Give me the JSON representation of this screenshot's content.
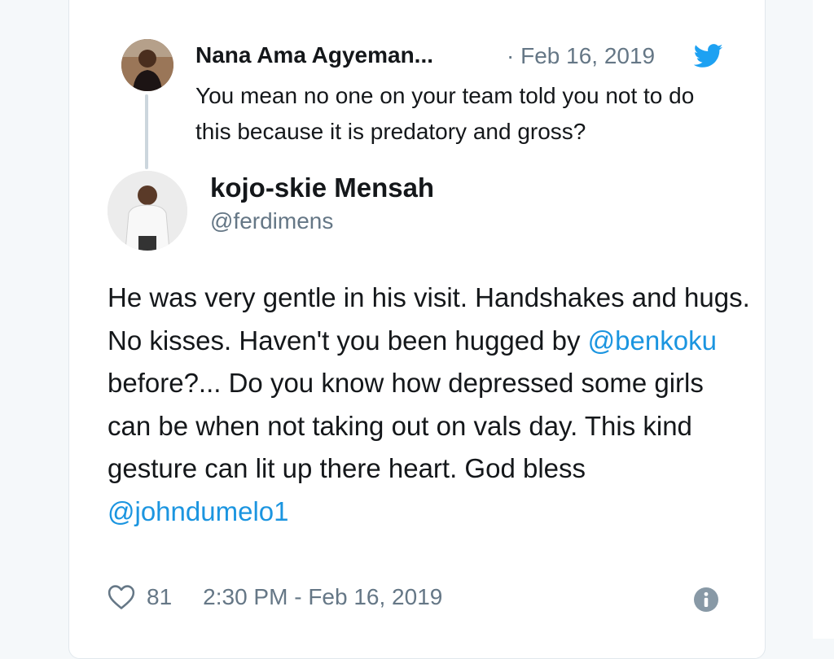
{
  "parent_tweet": {
    "name": "Nana Ama Agyeman...",
    "date": "· Feb 16, 2019",
    "text": "You mean no one on your team told you not to do this because it is predatory and gross?"
  },
  "main_tweet": {
    "name": "kojo-skie Mensah",
    "handle": "@ferdimens",
    "text_parts": {
      "p1": "He was very gentle in his visit. Handshakes and hugs. No kisses. Haven't you been hugged by ",
      "mention1": "@benkoku",
      "p2": " before?... Do you know how depressed some girls can be when not taking out on vals day. This kind gesture can lit up there heart. God bless ",
      "mention2": "@johndumelo1"
    },
    "likes": "81",
    "timestamp": "2:30 PM - Feb 16, 2019"
  },
  "icons": {
    "brand": "twitter-bird-icon",
    "like": "heart-icon",
    "info": "info-icon"
  },
  "colors": {
    "twitter_blue": "#1da1f2",
    "mention_blue": "#1b95e0",
    "text_primary": "#14171a",
    "text_secondary": "#657786"
  }
}
